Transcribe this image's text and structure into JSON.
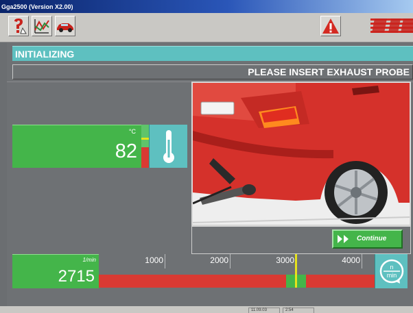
{
  "window": {
    "title": "Gga2500 (Version X2.00)"
  },
  "toolbar": {
    "buttons": [
      {
        "icon": "help-icon"
      },
      {
        "icon": "graph-icon"
      },
      {
        "icon": "car-icon"
      }
    ],
    "warning_icon": "warning-icon",
    "logo_icon": "brand-logo-icon"
  },
  "status": {
    "title": "INITIALIZING",
    "message": "PLEASE INSERT EXHAUST PROBE"
  },
  "temperature": {
    "unit": "°C",
    "value": "82",
    "gauge_level": 0.48,
    "icon": "thermometer-icon"
  },
  "instruction_image": {
    "subject": "exhaust-probe-in-tailpipe"
  },
  "continue_button": {
    "label": "Continue"
  },
  "rpm": {
    "unit": "1/min",
    "value": "2715",
    "ticks": [
      "1000",
      "2000",
      "3000",
      "4000"
    ],
    "needle_value": 3000,
    "green_band": [
      2850,
      3150
    ],
    "scale_max": 4200,
    "icon": "rpm-dial-icon"
  },
  "footer": {
    "cells": [
      "11.09.03",
      "2:54"
    ]
  },
  "colors": {
    "accent": "#5ec0c0",
    "panel_green": "#44b54a",
    "gauge_red": "#d93a33",
    "needle": "#e6e21c"
  }
}
